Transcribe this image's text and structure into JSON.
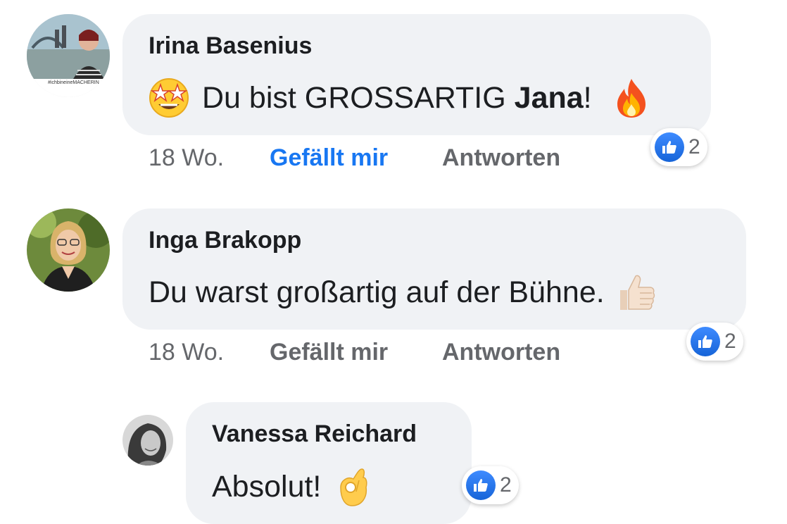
{
  "comments": [
    {
      "author": "Irina Basenius",
      "text_before": "Du bist GROSSARTIG ",
      "text_bold": "Jana",
      "text_after": "!",
      "leading_emoji": "star-struck-emoji",
      "trailing_emoji": "fire-emoji",
      "avatar_badge": "#ichbineineMACHERIN",
      "time": "18 Wo.",
      "like_label": "Gefällt mir",
      "like_active": true,
      "reply_label": "Antworten",
      "reaction_count": "2"
    },
    {
      "author": "Inga Brakopp",
      "text": "Du warst großartig auf der Bühne.",
      "trailing_emoji": "thumbs-up-emoji",
      "time": "18 Wo.",
      "like_label": "Gefällt mir",
      "like_active": false,
      "reply_label": "Antworten",
      "reaction_count": "2"
    },
    {
      "author": "Vanessa Reichard",
      "text": "Absolut!",
      "trailing_emoji": "ok-hand-emoji",
      "reaction_count": "2"
    }
  ],
  "colors": {
    "bubble": "#f0f2f5",
    "like_active": "#1877f2",
    "meta": "#65676b",
    "reaction_blue": "#1877f2"
  },
  "icons": [
    "like-icon",
    "star-struck-emoji",
    "fire-emoji",
    "thumbs-up-emoji",
    "ok-hand-emoji"
  ]
}
